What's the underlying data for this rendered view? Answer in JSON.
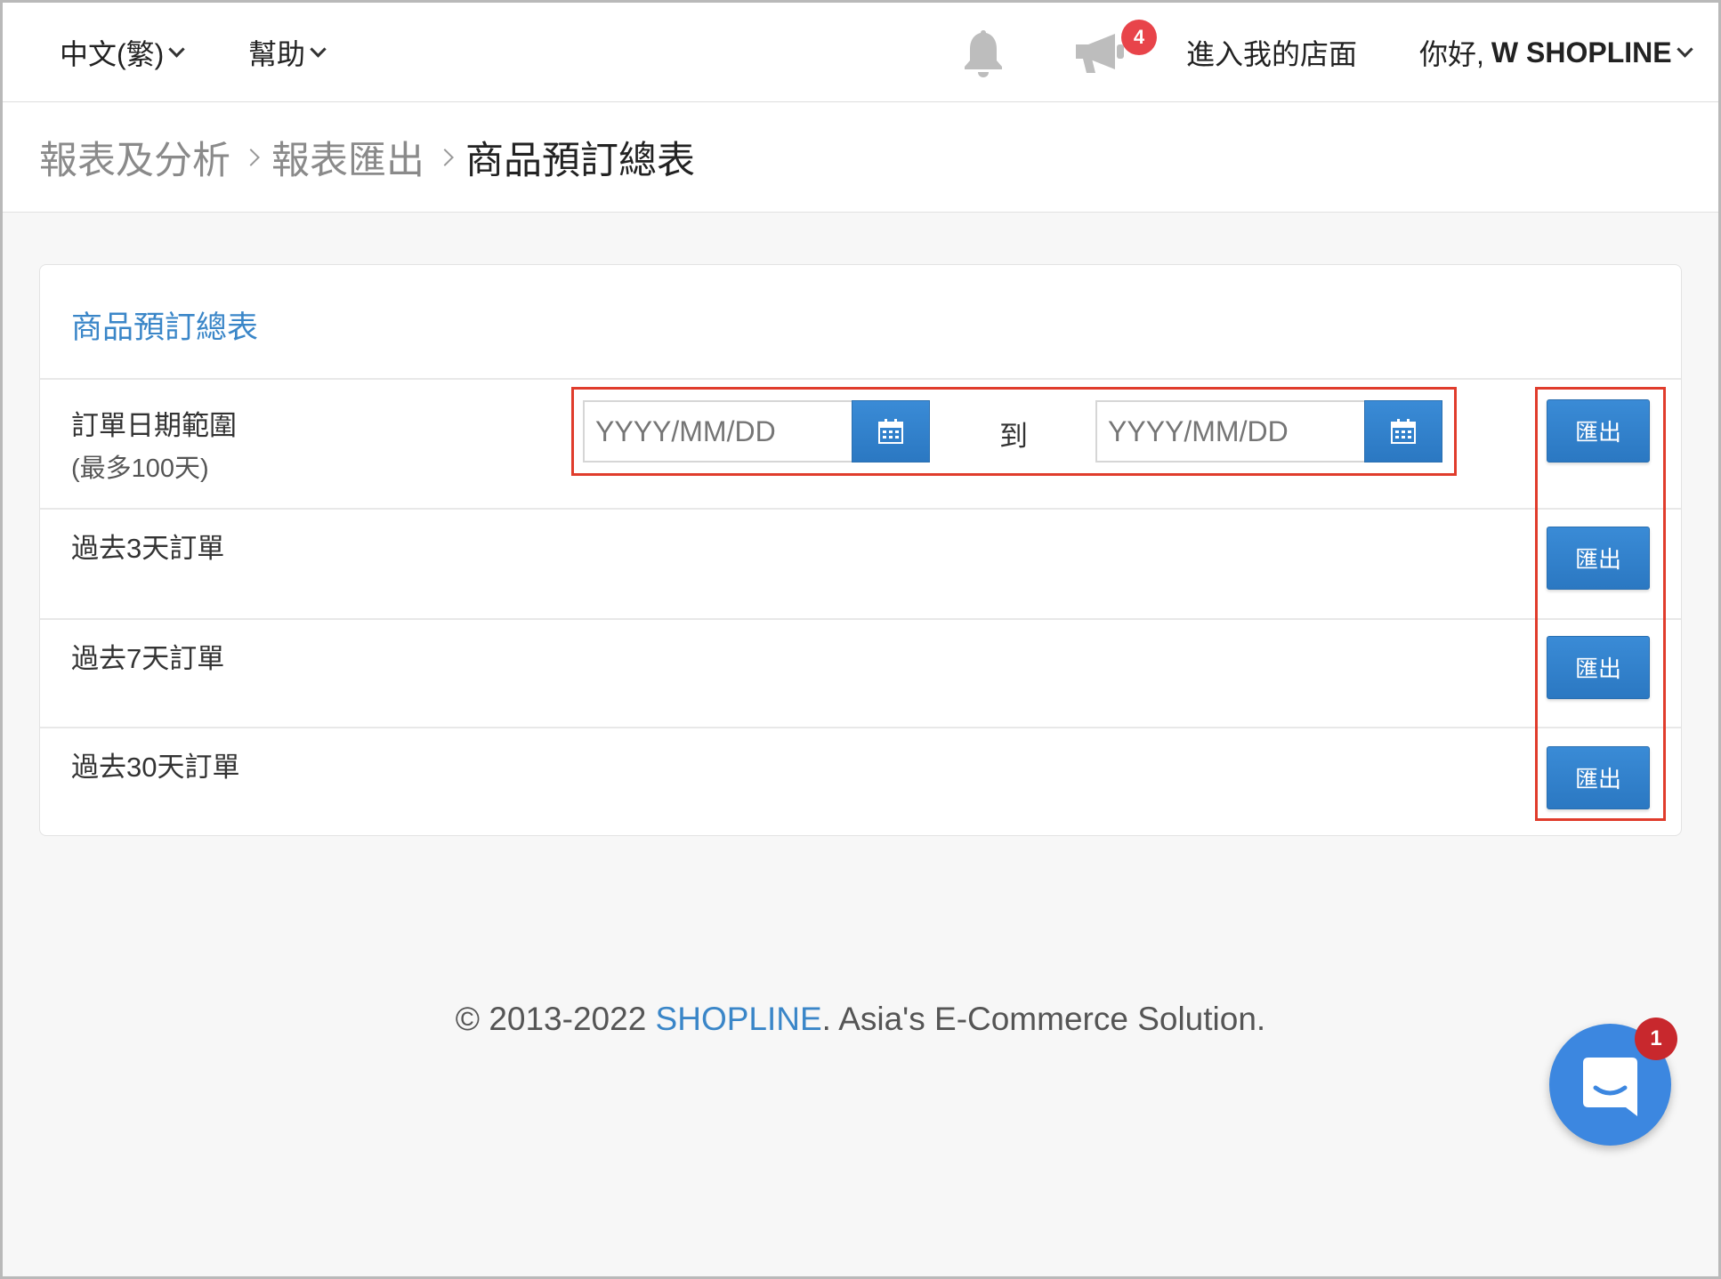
{
  "topbar": {
    "language": "中文(繁)",
    "help": "幫助",
    "notification_count": "4",
    "store_link": "進入我的店面",
    "greeting": "你好,",
    "user_name": "W SHOPLINE",
    "bell_icon": "bell-icon",
    "announcement_icon": "megaphone-icon"
  },
  "breadcrumb": {
    "items": [
      "報表及分析",
      "報表匯出",
      "商品預訂總表"
    ]
  },
  "card": {
    "title": "商品預訂總表",
    "date_range": {
      "label": "訂單日期範圍",
      "sublabel": "(最多100天)",
      "start_placeholder": "YYYY/MM/DD",
      "end_placeholder": "YYYY/MM/DD",
      "to_label": "到",
      "calendar_icon": "calendar-icon"
    },
    "rows": [
      {
        "label": "過去3天訂單"
      },
      {
        "label": "過去7天訂單"
      },
      {
        "label": "過去30天訂單"
      }
    ],
    "export_label": "匯出"
  },
  "footer": {
    "prefix": "© 2013-2022 ",
    "brand": "SHOPLINE",
    "suffix": ". Asia's E-Commerce Solution."
  },
  "chat": {
    "unread_count": "1",
    "icon": "chat-icon"
  },
  "colors": {
    "accent": "#3a86c8",
    "button": "#2f80cc",
    "highlight": "#e03c2c",
    "badge": "#e8444a"
  }
}
